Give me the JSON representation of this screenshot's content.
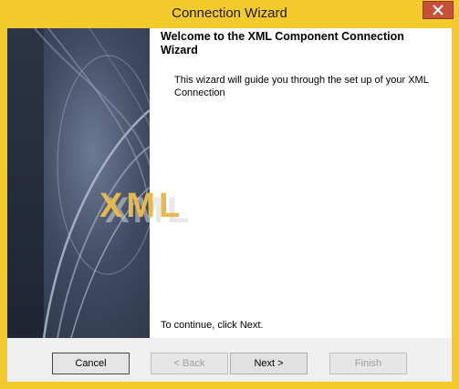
{
  "window": {
    "title": "Connection Wizard"
  },
  "side_panel": {
    "logo_text": "XML"
  },
  "content": {
    "heading": "Welcome to the XML Component Connection Wizard",
    "description": "This wizard will guide you through the set up of your XML Connection",
    "continue_text": "To continue, click Next."
  },
  "buttons": {
    "cancel": "Cancel",
    "back": "< Back",
    "next": "Next >",
    "finish": "Finish"
  },
  "colors": {
    "title_bar": "#f2ca2b",
    "close_button": "#c7503b",
    "logo": "#e8b84a"
  }
}
